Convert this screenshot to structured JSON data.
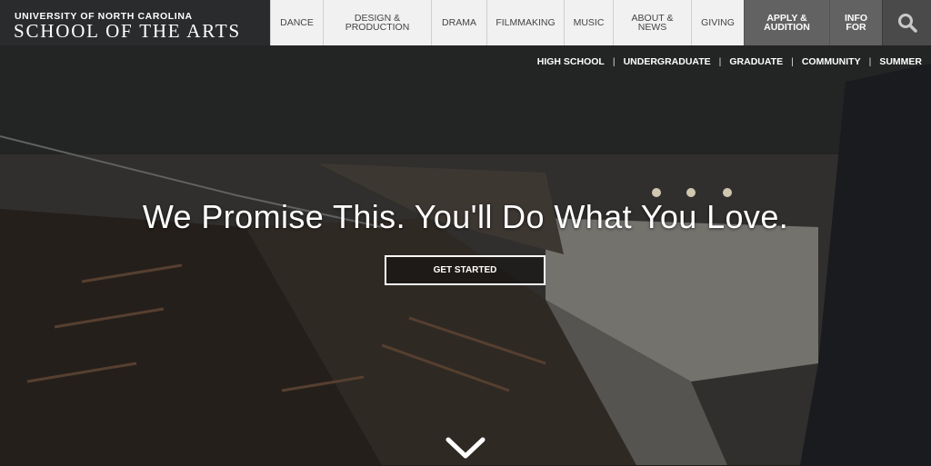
{
  "logo": {
    "line1": "UNIVERSITY OF NORTH CAROLINA",
    "line2": "SCHOOL OF THE ARTS"
  },
  "nav": {
    "items": [
      {
        "label": "DANCE"
      },
      {
        "label": "DESIGN & PRODUCTION"
      },
      {
        "label": "DRAMA"
      },
      {
        "label": "FILMMAKING"
      },
      {
        "label": "MUSIC"
      },
      {
        "label": "ABOUT & NEWS"
      },
      {
        "label": "GIVING"
      }
    ],
    "apply_label": "APPLY & AUDITION",
    "info_label": "INFO FOR",
    "search_icon": "search-icon"
  },
  "subnav": {
    "items": [
      "HIGH SCHOOL",
      "UNDERGRADUATE",
      "GRADUATE",
      "COMMUNITY",
      "SUMMER"
    ]
  },
  "hero": {
    "headline": "We Promise This. You'll Do What You Love.",
    "cta_label": "GET STARTED",
    "scroll_icon": "chevron-down-icon"
  },
  "colors": {
    "nav_bg": "#f1f1f1",
    "nav_dark": "#626262",
    "logo_bg": "#2a2b2d"
  }
}
